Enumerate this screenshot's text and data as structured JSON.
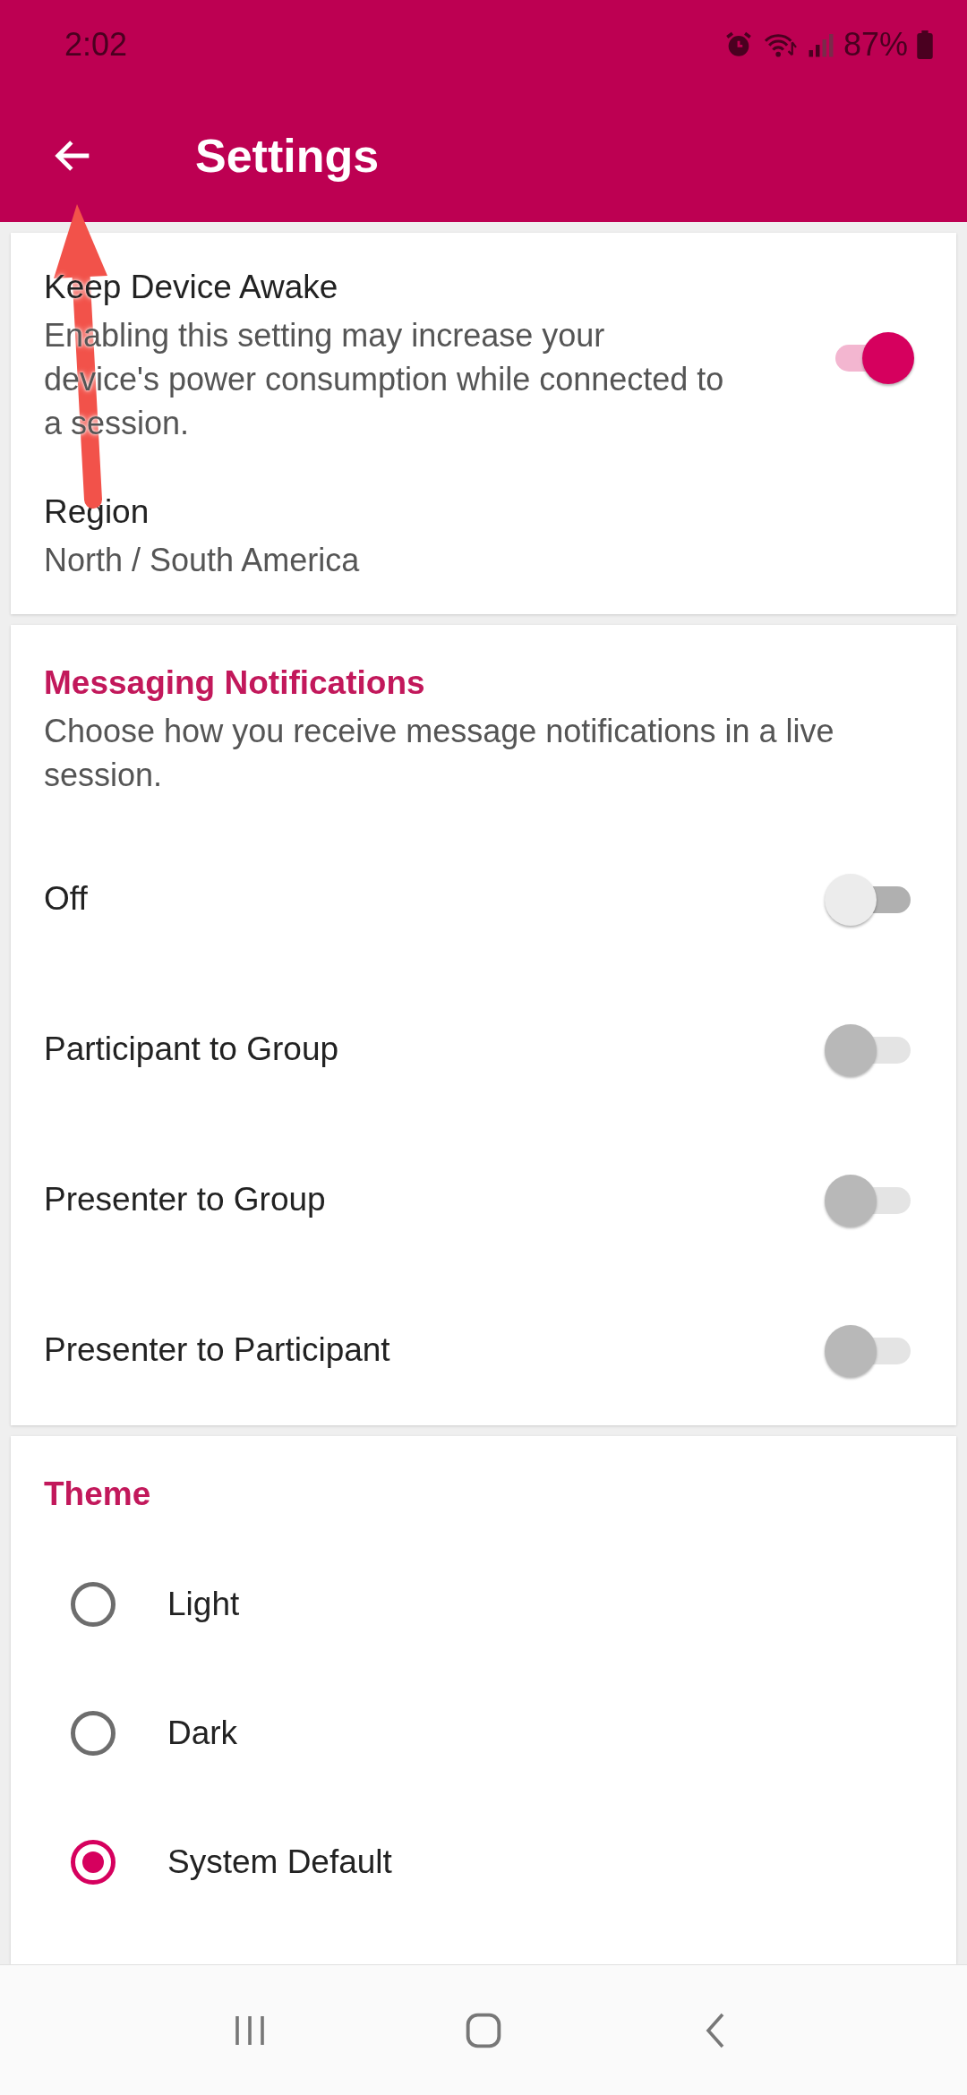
{
  "status_bar": {
    "time": "2:02",
    "battery": "87%"
  },
  "app_bar": {
    "title": "Settings"
  },
  "general": {
    "items": [
      {
        "kind": "toggle",
        "title": "Keep Device Awake",
        "description": "Enabling this setting may increase your device's power consumption while connected to a session.",
        "on": true,
        "disabled": false
      },
      {
        "kind": "value",
        "title": "Region",
        "value": "North / South America"
      }
    ]
  },
  "messaging": {
    "heading": "Messaging Notifications",
    "description": "Choose how you receive message notifications in a live session.",
    "options": [
      {
        "label": "Off",
        "on": false,
        "disabled": false
      },
      {
        "label": "Participant to Group",
        "on": false,
        "disabled": true
      },
      {
        "label": "Presenter to Group",
        "on": false,
        "disabled": true
      },
      {
        "label": "Presenter to Participant",
        "on": false,
        "disabled": true
      }
    ]
  },
  "theme": {
    "heading": "Theme",
    "options": [
      {
        "label": "Light",
        "selected": false
      },
      {
        "label": "Dark",
        "selected": false
      },
      {
        "label": "System Default",
        "selected": true
      }
    ]
  },
  "annotation": {
    "kind": "arrow"
  }
}
